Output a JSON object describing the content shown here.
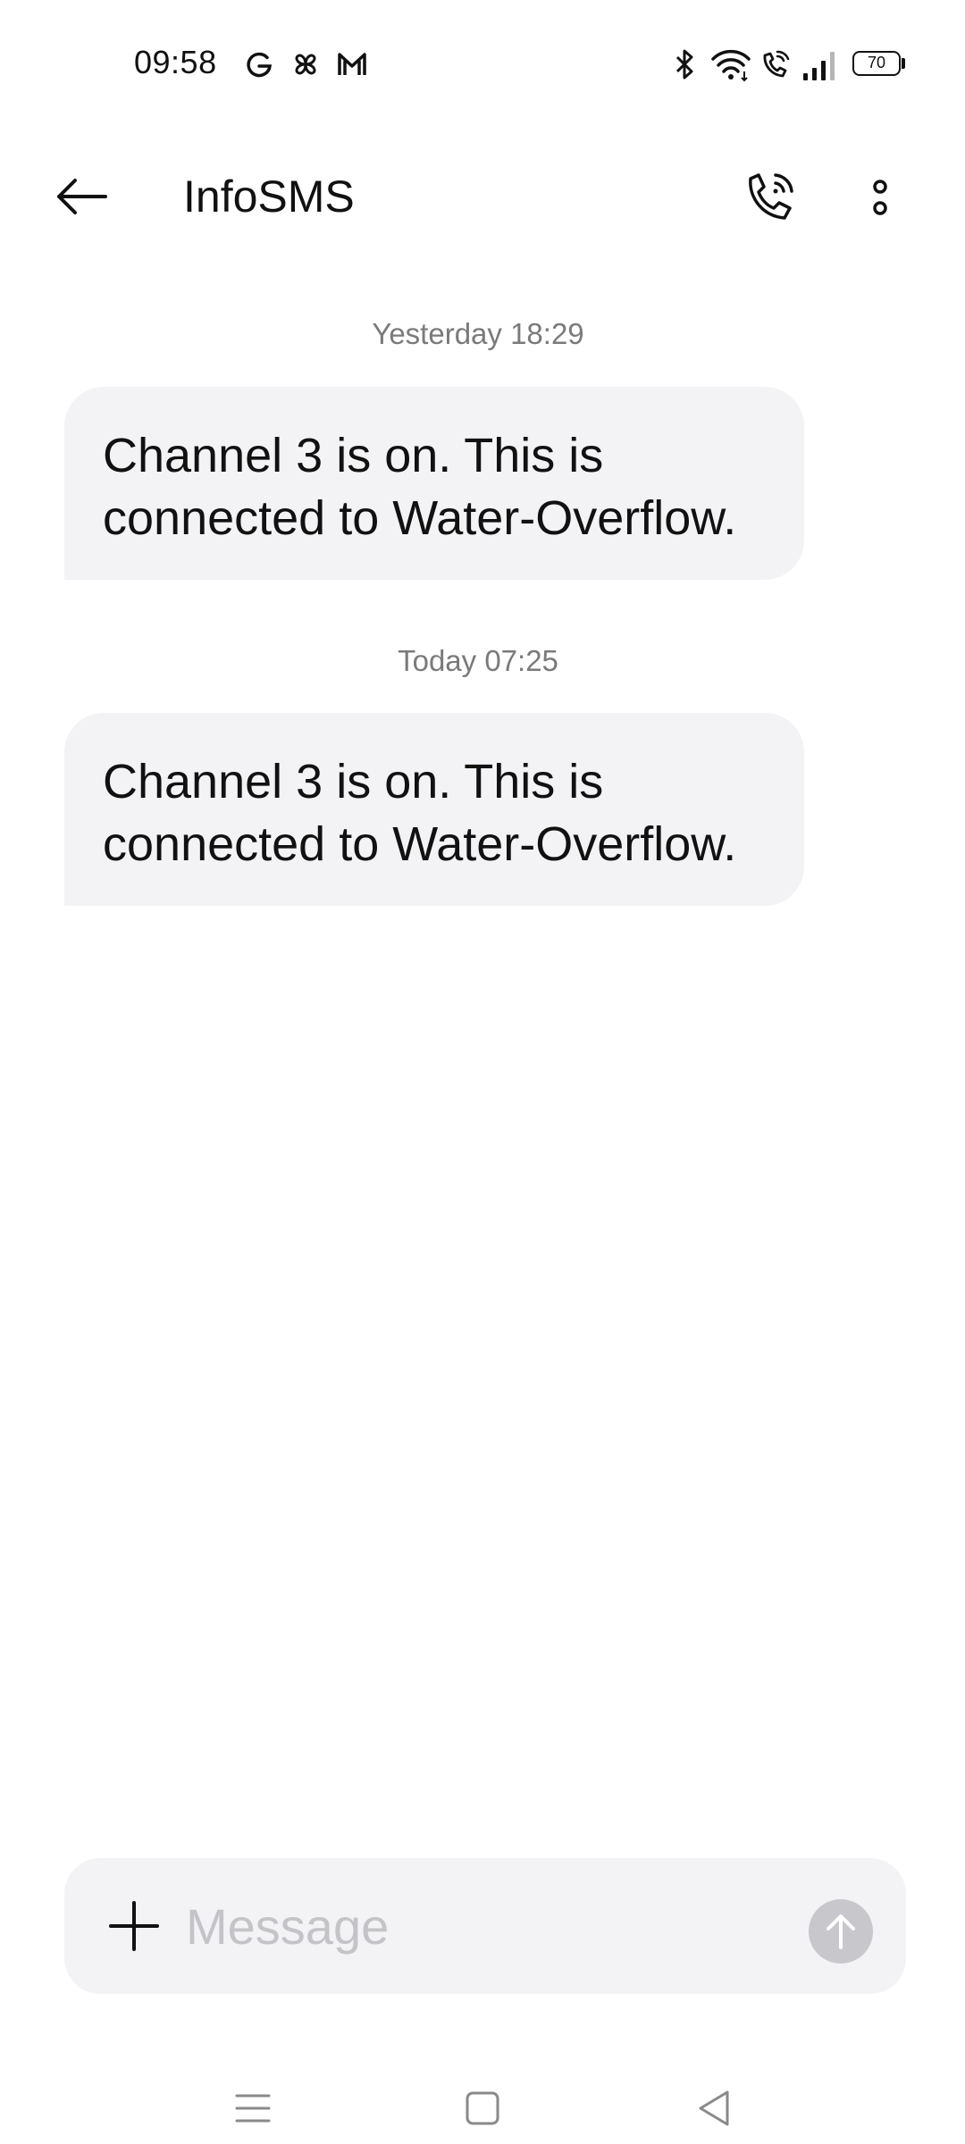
{
  "status_bar": {
    "time": "09:58",
    "notification_icons": [
      "g-icon",
      "pinwheel-icon",
      "gmail-icon"
    ],
    "system_icons": [
      "bluetooth-icon",
      "wifi-icon",
      "wifi-calling-icon",
      "signal-icon"
    ],
    "battery_level": "70"
  },
  "header": {
    "title": "InfoSMS",
    "back_icon": "arrow-left-icon",
    "call_icon": "wifi-call-icon",
    "menu_icon": "more-vertical-icon"
  },
  "conversation": {
    "groups": [
      {
        "timestamp": "Yesterday 18:29",
        "message": "Channel 3 is on. This is connected to Water-Overflow."
      },
      {
        "timestamp": "Today 07:25",
        "message": "Channel 3 is on. This is connected to Water-Overflow."
      }
    ]
  },
  "composer": {
    "placeholder": "Message",
    "value": "",
    "add_icon": "plus-icon",
    "send_icon": "arrow-up-icon"
  },
  "navigation": {
    "buttons": [
      "menu-icon",
      "home-square-icon",
      "back-triangle-icon"
    ]
  },
  "colors": {
    "bubble_background": "#f3f3f5",
    "timestamp_text": "#7a7a7a",
    "send_button": "#c7c7cc",
    "placeholder_text": "#c4c4c8"
  }
}
